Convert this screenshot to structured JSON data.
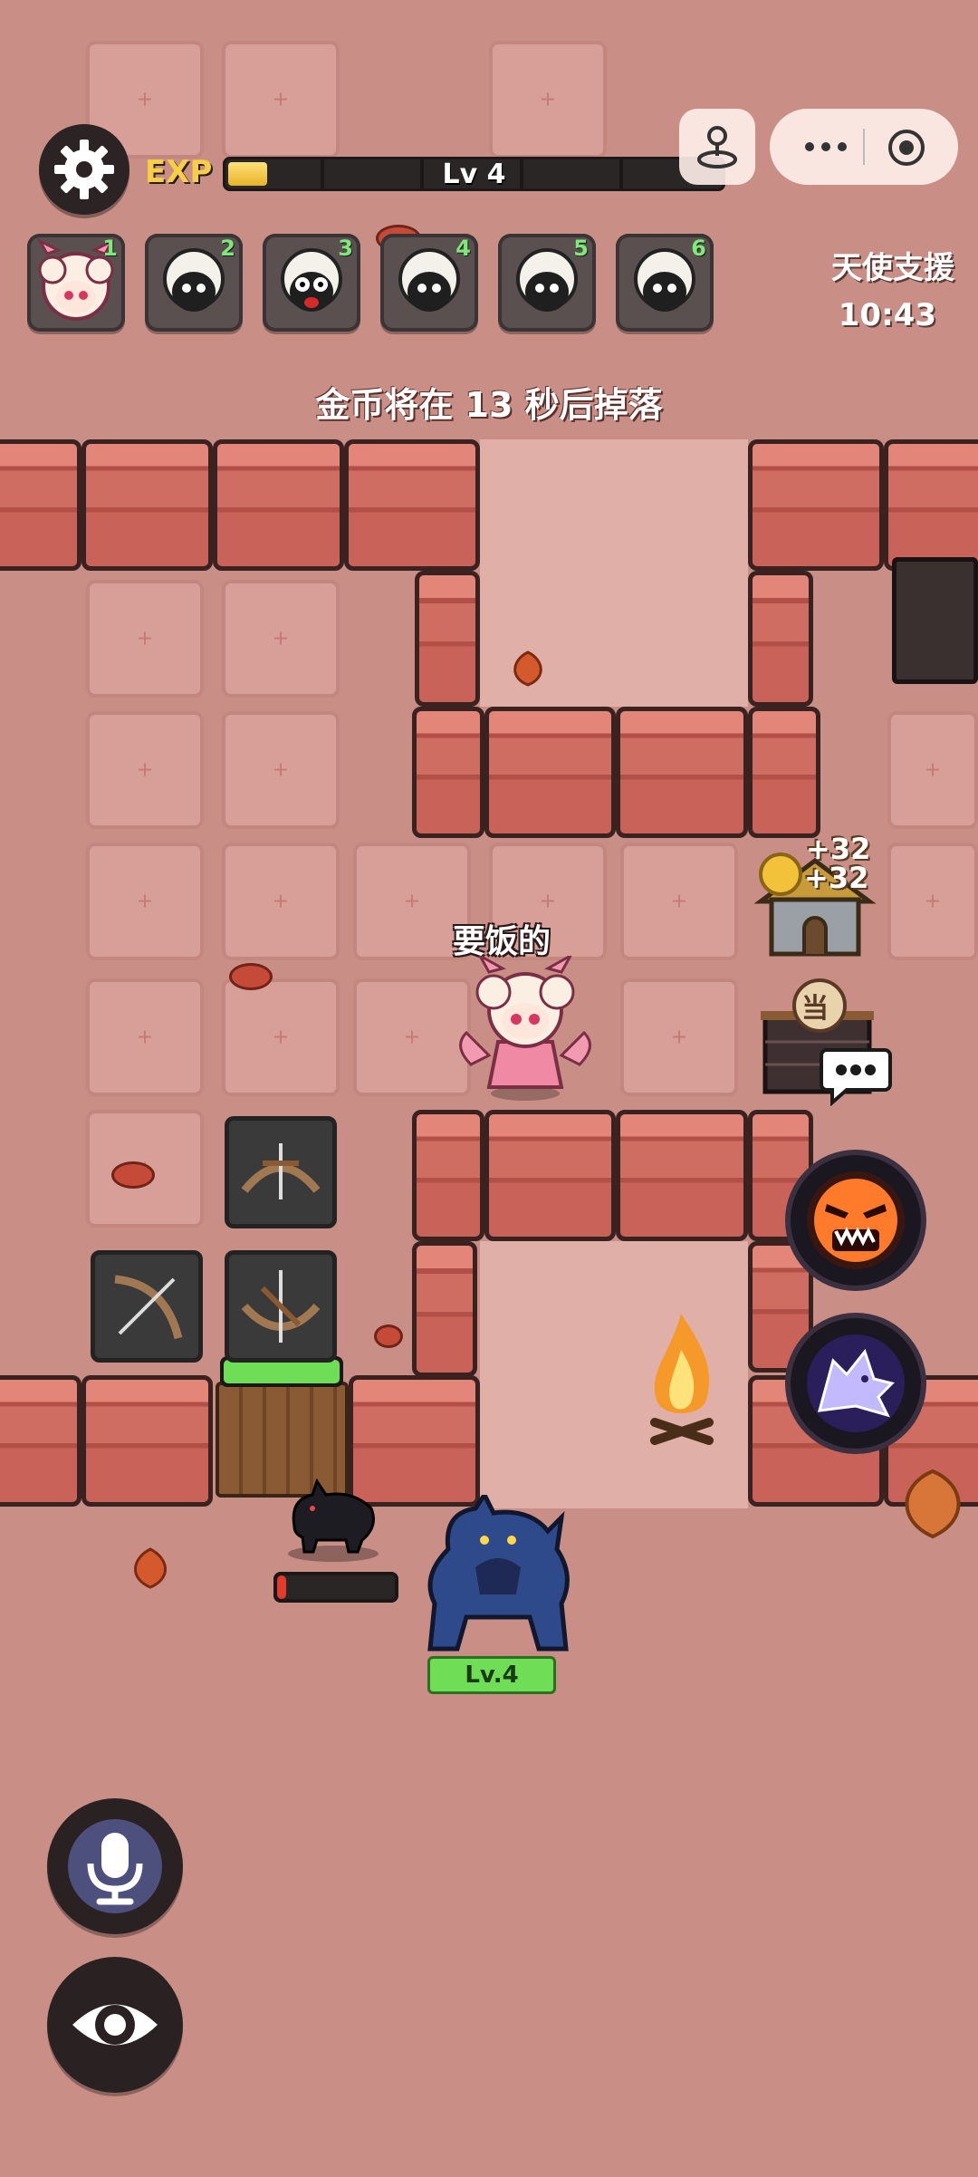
{
  "hud": {
    "exp_label": "EXP",
    "exp_progress": 0.08,
    "level_text": "Lv 4"
  },
  "party": [
    {
      "num": "1",
      "kind": "angel-girl"
    },
    {
      "num": "2",
      "kind": "sheep"
    },
    {
      "num": "3",
      "kind": "sheep-shocked"
    },
    {
      "num": "4",
      "kind": "sheep"
    },
    {
      "num": "5",
      "kind": "sheep"
    },
    {
      "num": "6",
      "kind": "sheep"
    }
  ],
  "support": {
    "label": "天使支援",
    "time": "10:43"
  },
  "coin_message": "金币将在 13 秒后掉落",
  "player_name": "要饭的",
  "gold_popups": [
    "+32",
    "+32"
  ],
  "shop_sign": "当",
  "gate_hp": 1.0,
  "wolf_hp": 0.08,
  "boss_level": "Lv.4",
  "colors": {
    "accent": "#f6cf45",
    "hp_green": "#6fdd55",
    "hp_red": "#e23a2e"
  }
}
